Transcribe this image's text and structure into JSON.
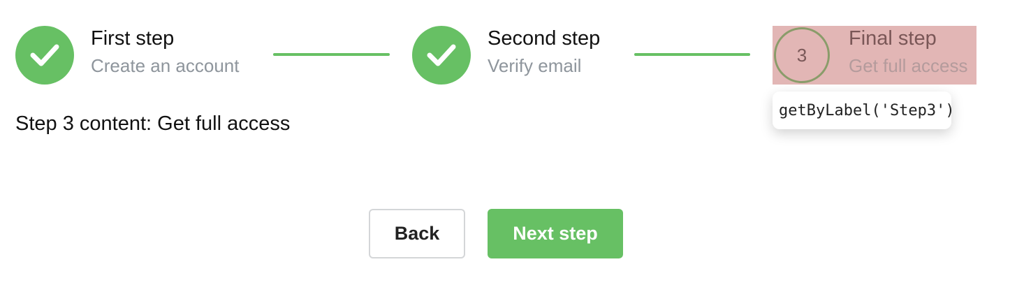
{
  "stepper": {
    "steps": [
      {
        "title": "First step",
        "description": "Create an account",
        "status": "completed",
        "icon": "check-icon"
      },
      {
        "title": "Second step",
        "description": "Verify email",
        "status": "completed",
        "icon": "check-icon"
      },
      {
        "title": "Final step",
        "description": "Get full access",
        "status": "active",
        "number": "3"
      }
    ]
  },
  "content": {
    "text": "Step 3 content: Get full access"
  },
  "tooltip": {
    "text": "getByLabel('Step3')"
  },
  "buttons": {
    "back_label": "Back",
    "next_label": "Next step"
  },
  "colors": {
    "accent": "#67c064",
    "highlight": "#e2b6b5",
    "muted_text": "#8e959c"
  }
}
